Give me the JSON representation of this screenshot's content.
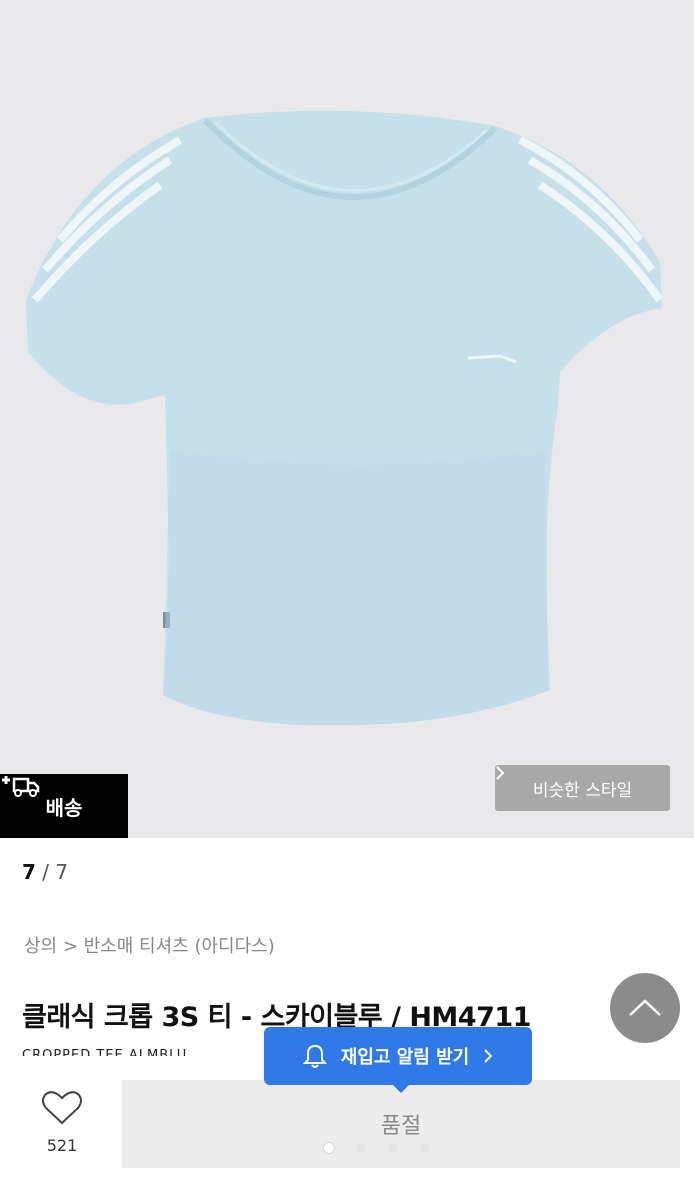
{
  "product": {
    "image_alt": "",
    "delivery_badge": "배송",
    "similar_style": "비슷한 스타일",
    "pager_current": "7",
    "pager_total": "/ 7",
    "breadcrumb": "상의 > 반소매 티셔츠 (아디다스)",
    "title": "클래식 크롭 3S 티 - 스카이블루 / HM4711",
    "subtitle": "CROPPED TEE ALMBLU"
  },
  "notify": {
    "label": "재입고 알림 받기"
  },
  "bottom": {
    "like_count": "521",
    "soldout_label": "품절"
  },
  "colors": {
    "accent": "#2f7ae8",
    "shirt": "#c5e0e9",
    "badge": "#000000"
  },
  "icons": [
    "truck-icon",
    "chevron-right-icon",
    "chevron-up-icon",
    "bell-icon",
    "heart-icon"
  ]
}
